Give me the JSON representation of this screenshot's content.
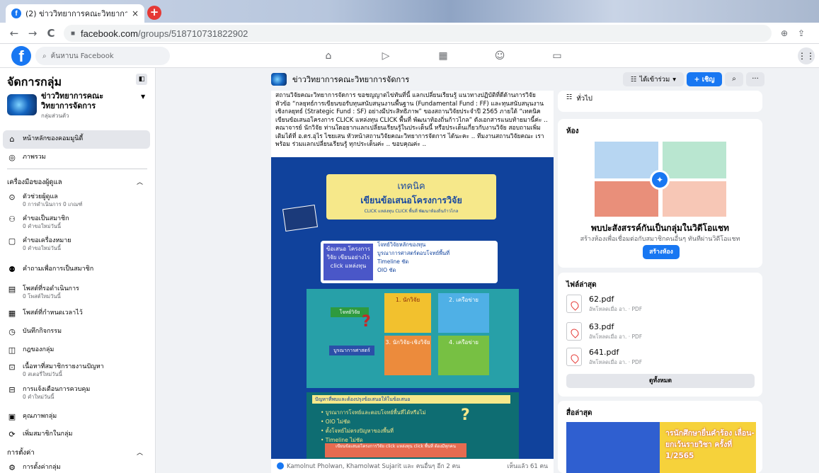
{
  "browser": {
    "tab_title": "(2) ข่าววิทยาการคณะวิทยาการจัดการ |",
    "tab_close": "×",
    "new_tab": "+",
    "back": "←",
    "forward": "→",
    "reload": "C",
    "url_domain": "facebook.com",
    "url_path": "/groups/518710731822902"
  },
  "fb": {
    "logo": "f",
    "search_placeholder": "ค้นหาบน Facebook"
  },
  "sidebar": {
    "title": "จัดการกลุ่ม",
    "group_name": "ข่าววิทยาการคณะวิทยาการจัดการ",
    "group_privacy": "กลุ่มส่วนตัว",
    "items_top": [
      {
        "label": "หน้าหลักของคอมมูนิตี้",
        "icon": "home-icon"
      },
      {
        "label": "ภาพรวม",
        "icon": "overview-icon"
      }
    ],
    "admin_tools": "เครื่องมือของผู้ดูแล",
    "tools": [
      {
        "label": "ตัวช่วยผู้ดูแล",
        "sub": "0 การดำเนินการ 0 เกณฑ์"
      },
      {
        "label": "คำขอเป็นสมาชิก",
        "sub": "0 คำขอใหม่วันนี้"
      },
      {
        "label": "คำขอเครื่องหมาย",
        "sub": "0 คำขอใหม่วันนี้"
      },
      {
        "label": "คำถามเพื่อการเป็นสมาชิก",
        "sub": ""
      },
      {
        "label": "โพสต์ที่รอดำเนินการ",
        "sub": "0 โพสต์ใหม่วันนี้"
      },
      {
        "label": "โพสต์ที่กำหนดเวลาไว้",
        "sub": ""
      },
      {
        "label": "บันทึกกิจกรรม",
        "sub": ""
      },
      {
        "label": "กฎของกลุ่ม",
        "sub": ""
      },
      {
        "label": "เนื้อหาที่สมาชิกรายงานปัญหา",
        "sub": "0 สเตอรี่ใหม่วันนี้"
      },
      {
        "label": "การแจ้งเตือนการควบคุม",
        "sub": "0 คำใหม่วันนี้"
      },
      {
        "label": "คุณภาพกลุ่ม",
        "sub": ""
      },
      {
        "label": "เพิ่มสมาชิกในกลุ่ม",
        "sub": ""
      }
    ],
    "settings": "การตั้งค่า",
    "group_settings": "การตั้งค่ากลุ่ม"
  },
  "header": {
    "group_name": "ข่าววิทยาการคณะวิทยาการจัดการ",
    "joined": "ได้เข้าร่วม",
    "invite": "+ เชิญ",
    "search_btn": "⌕",
    "more_btn": "···"
  },
  "post": {
    "text": "สถานวิจัยคณะวิทยาการจัดการ ขอชญญาตไข่ทันที่นี้ แลกเปลี่ยนเรียนรู้ แนวทางปฏิบัติที่ดีด้านการวิจัย หัวข้อ “กลยุทธ์การเขียนขอรับทุนสนับสนุนงานพื้นฐาน (Fundamental Fund : FF) และทุนสนับสนุนงานเชิงกลยุทธ์ (Strategic Fund : SF) อย่างมีประสิทธิภาพ” ของสถานวิจัยประจำปี 2565 ภายใต้ “เทคนิคเขียนข้อเสนอโครงการ CLICK แหล่งทุน CLICK พื้นที่ พัฒนาท้องถิ่นก้าวไกล” ดังเอกสารแนบท้ายมานี้ค่ะ .. คณาจารย์ นักวิจัย ท่านใดอยากแลกเปลี่ยนเรียนรู้ในประเด็นนี้ หรือประเด็นเกี่ยวกับงานวิจัย สอบถามเพิ่มเติมได้ที่ อ.ดร.อุไร ไชยเสน หัวหน้าสถานวิจัยคณะวิทยาการจัดการ ได้นะคะ .. ทีมงานสถานวิจัยคณะ เราพร้อม ร่วมแลกเปลี่ยนเรียนรู้ ทุกประเด็นค่ะ .. ขอบคุณค่ะ ..",
    "poster": {
      "t1": "เทคนิค",
      "t2": "เขียนข้อเสนอโครงการวิจัย",
      "t3": "CLICK แหล่งทุน CLICK พื้นที่ พัฒนาท้องถิ่นก้าวไกล",
      "box_left": "ข้อเสนอ โครงการวิจัย เขียนอย่างไร click แหล่งทุน",
      "bullets": [
        "โจทย์วิจัยหลักของทุน",
        "บูรณาการศาสตร์ตอบโจทย์พื้นที่",
        "Timeline ชัด",
        "OIO ชัด"
      ],
      "c1": "1. นักวิจัย",
      "c2": "2. เครือข่าย",
      "c3": "3. นักวิจัย-เชิงวิจัย",
      "c4": "4. เครือข่าย",
      "tag1": "โจทย์วิจัย",
      "tag2": "บูรณาการศาสตร์",
      "low_hdr": "ปัญหาที่พบและต้องปรุงข้อเสนอให้ในข้อเสนอ",
      "low_list": [
        "• บูรณาการโจทย์และตอบโจทย์พื้นที่ได้หรือไม่",
        "• OIO ไม่ชัด",
        "• ตั้งโจทย์ไม่ตรงปัญหาของพื้นที่",
        "• Timeline ไม่ชัด"
      ],
      "low_foot": "เขียนข้อเสนอโครงการวิจัย click แหล่งทุน click พื้นที่ ต้องมีทุกคน"
    },
    "reactors": "Kamolnut Pholwan, Khamolwat Sujarit และ คนอื่นๆ อีก 2 คน",
    "seen": "เห็นแล้ว 61 คน"
  },
  "right": {
    "general": "ทั่วไป",
    "rooms_h": "ห้อง",
    "rooms_title": "พบปะสังสรรค์กันเป็นกลุ่มในวิดีโอแชท",
    "rooms_sub": "สร้างห้องเพื่อเชื่อมต่อกับสมาชิกคนอื่นๆ ทันทีผ่านวิดีโอแชท",
    "rooms_btn": "สร้างห้อง",
    "files_h": "ไฟล์ล่าสุด",
    "files": [
      {
        "name": "62.pdf",
        "sub": "อัพโหลดเมื่อ อา. · PDF"
      },
      {
        "name": "63.pdf",
        "sub": "อัพโหลดเมื่อ อา. · PDF"
      },
      {
        "name": "641.pdf",
        "sub": "อัพโหลดเมื่อ อา. · PDF"
      }
    ],
    "see_all": "ดูทั้งหมด",
    "latest_h": "สื่อล่าสุด",
    "latest_text": "ารนักศึกษายื่นคำร้อง เลื่อน-ยกเว้นรายวิชา ครั้งที่ 1/2565"
  }
}
